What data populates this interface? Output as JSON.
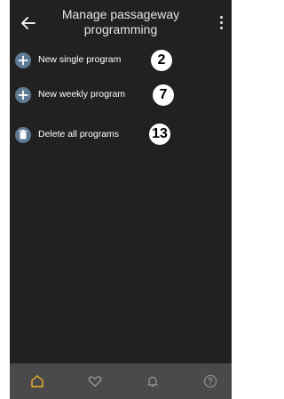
{
  "header": {
    "title": "Manage passageway\nprogramming",
    "back_icon": "arrow-left-icon",
    "more_icon": "kebab-menu-icon"
  },
  "menu": [
    {
      "label": "New single program",
      "icon": "plus-circle-icon",
      "callout": "2"
    },
    {
      "label": "New weekly program",
      "icon": "plus-circle-icon",
      "callout": "7"
    },
    {
      "label": "Delete all programs",
      "icon": "trash-circle-icon",
      "callout": "13"
    }
  ],
  "bottom_nav": [
    {
      "icon": "home-icon",
      "active": true
    },
    {
      "icon": "heart-icon",
      "active": false
    },
    {
      "icon": "bell-icon",
      "active": false
    },
    {
      "icon": "help-icon",
      "active": false
    }
  ],
  "colors": {
    "background": "#212121",
    "nav_background": "#4a4a4a",
    "icon_circle": "#5e7a93",
    "active_nav": "#f0b429",
    "inactive_nav": "#9a9a9a"
  }
}
